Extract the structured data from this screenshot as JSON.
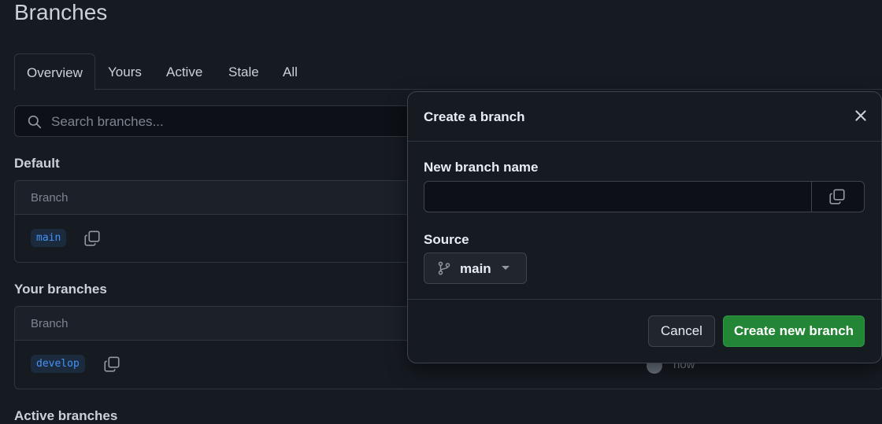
{
  "page": {
    "title": "Branches"
  },
  "tabs": [
    {
      "label": "Overview",
      "active": true
    },
    {
      "label": "Yours",
      "active": false
    },
    {
      "label": "Active",
      "active": false
    },
    {
      "label": "Stale",
      "active": false
    },
    {
      "label": "All",
      "active": false
    }
  ],
  "search": {
    "placeholder": "Search branches..."
  },
  "sections": {
    "default": {
      "title": "Default",
      "column_header": "Branch",
      "rows": [
        {
          "branch": "main"
        }
      ]
    },
    "yours": {
      "title": "Your branches",
      "column_header": "Branch",
      "rows": [
        {
          "branch": "develop",
          "updated": "now"
        }
      ]
    },
    "active": {
      "title": "Active branches"
    }
  },
  "modal": {
    "title": "Create a branch",
    "name_label": "New branch name",
    "name_value": "",
    "source_label": "Source",
    "source_value": "main",
    "cancel_label": "Cancel",
    "create_label": "Create new branch"
  },
  "icons": {
    "search": "search-icon",
    "copy": "copy-icon",
    "close": "close-icon",
    "branch": "git-branch-icon",
    "caret": "caret-down-icon"
  },
  "colors": {
    "background": "#161b22",
    "accent_link": "#4493f8",
    "primary_button": "#238636"
  }
}
